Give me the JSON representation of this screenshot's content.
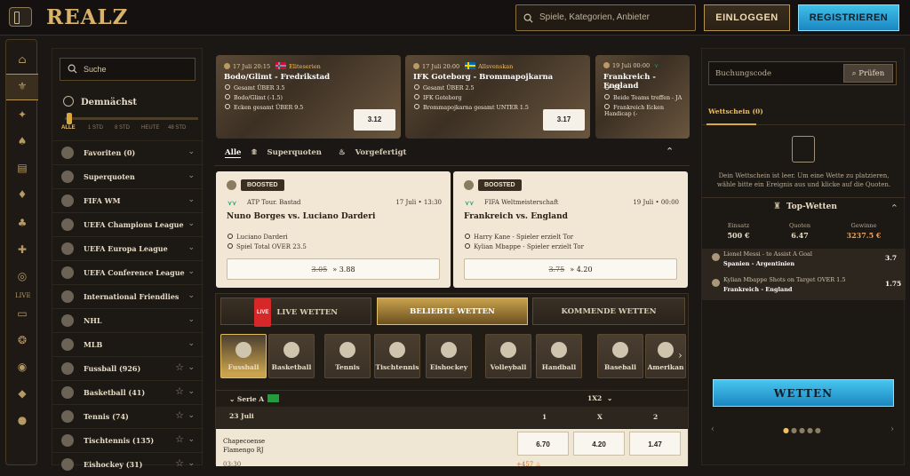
{
  "header": {
    "logo": "REALZ",
    "search_placeholder": "Spiele, Kategorien, Anbieter",
    "login": "EINLOGGEN",
    "register": "REGISTRIEREN"
  },
  "left": {
    "search_placeholder": "Suche",
    "upcoming": "Demnächst",
    "ticks": [
      "ALLE",
      "1 STD",
      "8 STD",
      "HEUTE",
      "48 STD"
    ],
    "items": [
      {
        "label": "Favoriten (0)"
      },
      {
        "label": "Superquoten"
      },
      {
        "label": "FIFA WM"
      },
      {
        "label": "UEFA Champions League"
      },
      {
        "label": "UEFA Europa League"
      },
      {
        "label": "UEFA Conference League"
      },
      {
        "label": "International Friendlies"
      },
      {
        "label": "NHL"
      },
      {
        "label": "MLB"
      },
      {
        "label": "Fussball (926)"
      },
      {
        "label": "Basketball (41)"
      },
      {
        "label": "Tennis (74)"
      },
      {
        "label": "Tischtennis (135)"
      },
      {
        "label": "Eishockey (31)"
      }
    ]
  },
  "hero": [
    {
      "date": "17 Juli 20:15",
      "league": "Eliteserien",
      "title": "Bodo/Glimt - Fredrikstad",
      "sels": [
        "Gesamt ÜBER 3.5",
        "Bodo/Glimt (-1.5)",
        "Ecken gesamt ÜBER 9.5"
      ],
      "odds": "3.12"
    },
    {
      "date": "17 Juli 20:00",
      "league": "Allsvenskan",
      "title": "IFK Goteborg - Brommapojkarna",
      "sels": [
        "Gesamt ÜBER 2.5",
        "IFK Goteborg",
        "Brommapojkarna gesamt UNTER 1.5"
      ],
      "odds": "3.17"
    },
    {
      "date": "19 Juli 00:00",
      "league": "",
      "title": "Frankreich - England",
      "sels": [
        "1X",
        "Beide Teams treffen - JA",
        "Frankreich Ecken Handicap (-"
      ],
      "odds": ""
    }
  ],
  "tabs": {
    "all": "Alle",
    "super": "Superquoten",
    "pre": "Vorgefertigt"
  },
  "boosted": [
    {
      "badge": "BOOSTED",
      "league": "ATP Tour. Bastad",
      "date": "17 Juli • 13:30",
      "title": "Nuno Borges vs. Luciano Darderi",
      "lines": [
        "Luciano Darderi",
        "Spiel Total OVER 23.5"
      ],
      "old": "3.05",
      "new": "3.88"
    },
    {
      "badge": "BOOSTED",
      "league": "FIFA Weltmeisterschaft",
      "date": "19 Juli • 00:00",
      "title": "Frankreich vs. England",
      "lines": [
        "Harry Kane - Spieler erzielt Tor",
        "Kylian Mbappe - Spieler erzielt Tor"
      ],
      "old": "3.75",
      "new": "4.20"
    }
  ],
  "segments": {
    "live_badge": "LIVE",
    "live": "LIVE WETTEN",
    "popular": "BELIEBTE WETTEN",
    "upcoming": "KOMMENDE WETTEN"
  },
  "sports": [
    "Fussball",
    "Basketball",
    "Tennis",
    "Tischtennis",
    "Eishockey",
    "Volleyball",
    "Handball",
    "Baseball",
    "Amerikan"
  ],
  "match": {
    "league": "Serie A",
    "market": "1X2",
    "date": "23 Juli",
    "c1": "1",
    "cx": "X",
    "c2": "2",
    "home": "Chapecoense",
    "away": "Flamengo RJ",
    "time": "03:30",
    "more": "+457",
    "o1": "6.70",
    "ox": "4.20",
    "o2": "1.47"
  },
  "right": {
    "code_placeholder": "Buchungscode",
    "check": "Prüfen",
    "slip": "Wettschein (0)",
    "empty": "Dein Wettschein ist leer. Um eine Wette zu platzieren, wähle bitte ein Ereignis aus und klicke auf die Quoten.",
    "top": "Top-Wetten",
    "stake_l": "Einsatz",
    "stake": "500 €",
    "odds_l": "Quoten",
    "odds": "6.47",
    "win_l": "Gewinne",
    "win": "3237.5 €",
    "bets": [
      {
        "sel": "Lionel Messi - to Assist A Goal",
        "match": "Spanien - Argentinien",
        "q": "3.7"
      },
      {
        "sel": "Kylian Mbappe Shots on Target OVER 1.5",
        "match": "Frankreich - England",
        "q": "1.75"
      }
    ],
    "bet_btn": "WETTEN"
  }
}
